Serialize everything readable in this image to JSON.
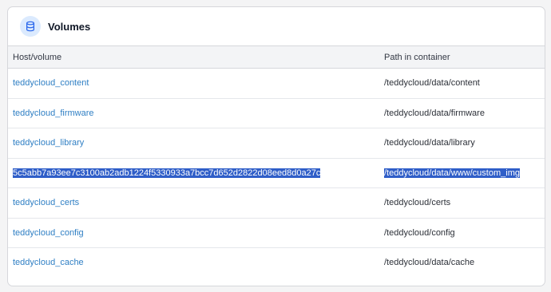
{
  "panel": {
    "title": "Volumes",
    "icon": "database-icon"
  },
  "table": {
    "columns": [
      "Host/volume",
      "Path in container"
    ],
    "rows": [
      {
        "host": "teddycloud_content",
        "path": "/teddycloud/data/content",
        "selected": false
      },
      {
        "host": "teddycloud_firmware",
        "path": "/teddycloud/data/firmware",
        "selected": false
      },
      {
        "host": "teddycloud_library",
        "path": "/teddycloud/data/library",
        "selected": false
      },
      {
        "host": "5c5abb7a93ee7c3100ab2adb1224f5330933a7bcc7d652d2822d08eed8d0a27c",
        "path": "/teddycloud/data/www/custom_img",
        "selected": true
      },
      {
        "host": "teddycloud_certs",
        "path": "/teddycloud/certs",
        "selected": false
      },
      {
        "host": "teddycloud_config",
        "path": "/teddycloud/config",
        "selected": false
      },
      {
        "host": "teddycloud_cache",
        "path": "/teddycloud/data/cache",
        "selected": false
      }
    ]
  },
  "colors": {
    "link": "#2f7fc4",
    "selection": "#2f5ec8",
    "icon_bg": "#dbeafe",
    "icon_fg": "#2563eb"
  }
}
